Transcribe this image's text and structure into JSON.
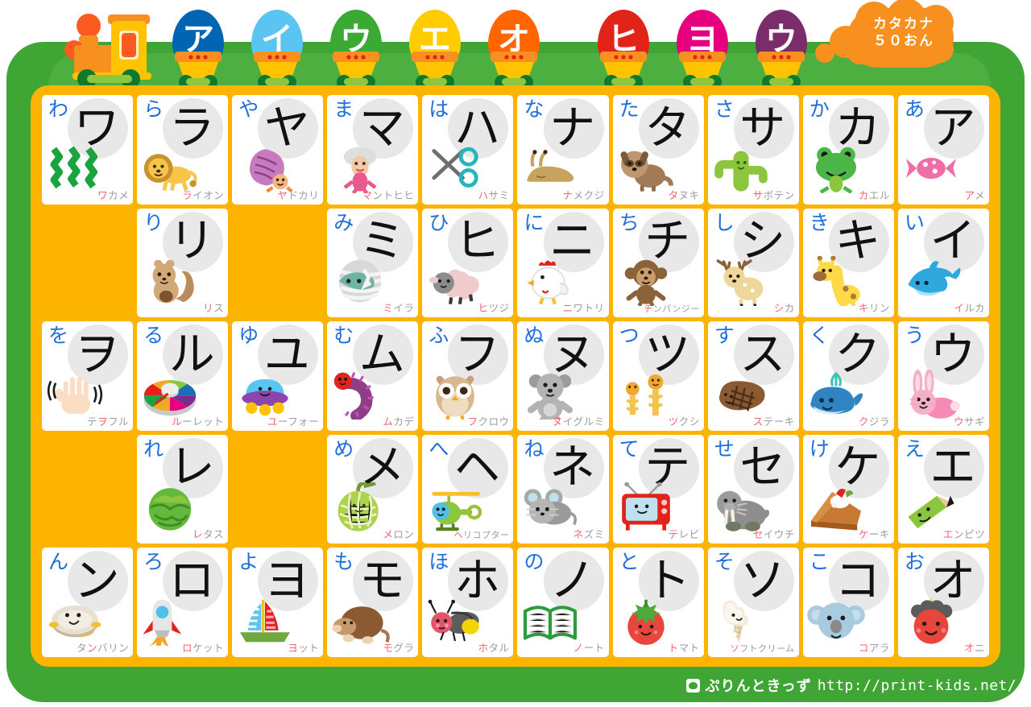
{
  "header": {
    "title_chars": [
      {
        "kana": "ア",
        "color": "#0066B3"
      },
      {
        "kana": "イ",
        "color": "#5BC5F2"
      },
      {
        "kana": "ウ",
        "color": "#3AAA35"
      },
      {
        "kana": "エ",
        "color": "#FFCC00"
      },
      {
        "kana": "オ",
        "color": "#FF6600"
      },
      {
        "kana": "ヒ",
        "color": "#E2231A"
      },
      {
        "kana": "ヨ",
        "color": "#E6007E"
      },
      {
        "kana": "ウ",
        "color": "#7B2D6B"
      }
    ],
    "cloud_line1": "カタカナ",
    "cloud_line2": "５０おん"
  },
  "footer": {
    "brand": "ぷりんときっず",
    "url": "http://print-kids.net/"
  },
  "colors": {
    "board_green": "#3FA535",
    "panel_orange": "#FCB400",
    "cell_white": "#FFFFFF",
    "kana_circle": "#E8E8E8",
    "hiragana_blue": "#1E6FD9",
    "katakana_black": "#111111",
    "word_gray": "#9B9B9B",
    "word_accent": "#F4636E",
    "smoke_orange": "#F7901E"
  },
  "grid": {
    "columns": 10,
    "rows": 5,
    "cells": [
      {
        "hira": "わ",
        "kata": "ワ",
        "word": "ワカメ",
        "hl": 0,
        "pic": "seaweed"
      },
      {
        "hira": "ら",
        "kata": "ラ",
        "word": "ライオン",
        "hl": 0,
        "pic": "lion"
      },
      {
        "hira": "や",
        "kata": "ヤ",
        "word": "ヤドカリ",
        "hl": 0,
        "pic": "hermit-crab"
      },
      {
        "hira": "ま",
        "kata": "マ",
        "word": "マントヒヒ",
        "hl": 0,
        "pic": "mandrill"
      },
      {
        "hira": "は",
        "kata": "ハ",
        "word": "ハサミ",
        "hl": 0,
        "pic": "scissors"
      },
      {
        "hira": "な",
        "kata": "ナ",
        "word": "ナメクジ",
        "hl": 0,
        "pic": "slug"
      },
      {
        "hira": "た",
        "kata": "タ",
        "word": "タヌキ",
        "hl": 0,
        "pic": "raccoon-dog"
      },
      {
        "hira": "さ",
        "kata": "サ",
        "word": "サボテン",
        "hl": 0,
        "pic": "cactus"
      },
      {
        "hira": "か",
        "kata": "カ",
        "word": "カエル",
        "hl": 0,
        "pic": "frog"
      },
      {
        "hira": "あ",
        "kata": "ア",
        "word": "アメ",
        "hl": 0,
        "pic": "candy"
      },
      {
        "hira": "",
        "kata": "",
        "word": "",
        "hl": -1,
        "pic": ""
      },
      {
        "hira": "り",
        "kata": "リ",
        "word": "リス",
        "hl": 0,
        "pic": "squirrel"
      },
      {
        "hira": "",
        "kata": "",
        "word": "",
        "hl": -1,
        "pic": ""
      },
      {
        "hira": "み",
        "kata": "ミ",
        "word": "ミイラ",
        "hl": 0,
        "pic": "mummy"
      },
      {
        "hira": "ひ",
        "kata": "ヒ",
        "word": "ヒツジ",
        "hl": 0,
        "pic": "sheep"
      },
      {
        "hira": "に",
        "kata": "ニ",
        "word": "ニワトリ",
        "hl": 0,
        "pic": "chicken"
      },
      {
        "hira": "ち",
        "kata": "チ",
        "word": "チンパンジー",
        "hl": 0,
        "pic": "chimpanzee"
      },
      {
        "hira": "し",
        "kata": "シ",
        "word": "シカ",
        "hl": 0,
        "pic": "deer"
      },
      {
        "hira": "き",
        "kata": "キ",
        "word": "キリン",
        "hl": 0,
        "pic": "giraffe"
      },
      {
        "hira": "い",
        "kata": "イ",
        "word": "イルカ",
        "hl": 0,
        "pic": "dolphin"
      },
      {
        "hira": "を",
        "kata": "ヲ",
        "word": "テヲフル",
        "hl": 1,
        "pic": "waving-hand"
      },
      {
        "hira": "る",
        "kata": "ル",
        "word": "ルーレット",
        "hl": 0,
        "pic": "roulette"
      },
      {
        "hira": "ゆ",
        "kata": "ユ",
        "word": "ユーフォー",
        "hl": 0,
        "pic": "ufo"
      },
      {
        "hira": "む",
        "kata": "ム",
        "word": "ムカデ",
        "hl": 0,
        "pic": "centipede"
      },
      {
        "hira": "ふ",
        "kata": "フ",
        "word": "フクロウ",
        "hl": 0,
        "pic": "owl"
      },
      {
        "hira": "ぬ",
        "kata": "ヌ",
        "word": "ヌイグルミ",
        "hl": 0,
        "pic": "stuffed-bear"
      },
      {
        "hira": "つ",
        "kata": "ツ",
        "word": "ツクシ",
        "hl": 0,
        "pic": "horsetail"
      },
      {
        "hira": "す",
        "kata": "ス",
        "word": "ステーキ",
        "hl": 0,
        "pic": "steak"
      },
      {
        "hira": "く",
        "kata": "ク",
        "word": "クジラ",
        "hl": 0,
        "pic": "whale"
      },
      {
        "hira": "う",
        "kata": "ウ",
        "word": "ウサギ",
        "hl": 0,
        "pic": "rabbit"
      },
      {
        "hira": "",
        "kata": "",
        "word": "",
        "hl": -1,
        "pic": ""
      },
      {
        "hira": "れ",
        "kata": "レ",
        "word": "レタス",
        "hl": 0,
        "pic": "lettuce"
      },
      {
        "hira": "",
        "kata": "",
        "word": "",
        "hl": -1,
        "pic": ""
      },
      {
        "hira": "め",
        "kata": "メ",
        "word": "メロン",
        "hl": 0,
        "pic": "melon"
      },
      {
        "hira": "へ",
        "kata": "ヘ",
        "word": "ヘリコプター",
        "hl": 0,
        "pic": "helicopter"
      },
      {
        "hira": "ね",
        "kata": "ネ",
        "word": "ネズミ",
        "hl": 0,
        "pic": "mouse"
      },
      {
        "hira": "て",
        "kata": "テ",
        "word": "テレビ",
        "hl": 0,
        "pic": "television"
      },
      {
        "hira": "せ",
        "kata": "セ",
        "word": "セイウチ",
        "hl": 0,
        "pic": "walrus"
      },
      {
        "hira": "け",
        "kata": "ケ",
        "word": "ケーキ",
        "hl": 0,
        "pic": "cake"
      },
      {
        "hira": "え",
        "kata": "エ",
        "word": "エンピツ",
        "hl": 0,
        "pic": "pencil"
      },
      {
        "hira": "ん",
        "kata": "ン",
        "word": "タンバリン",
        "hl": 1,
        "pic": "tambourine"
      },
      {
        "hira": "ろ",
        "kata": "ロ",
        "word": "ロケット",
        "hl": 0,
        "pic": "rocket"
      },
      {
        "hira": "よ",
        "kata": "ヨ",
        "word": "ヨット",
        "hl": 0,
        "pic": "yacht"
      },
      {
        "hira": "も",
        "kata": "モ",
        "word": "モグラ",
        "hl": 0,
        "pic": "mole"
      },
      {
        "hira": "ほ",
        "kata": "ホ",
        "word": "ホタル",
        "hl": 0,
        "pic": "firefly"
      },
      {
        "hira": "の",
        "kata": "ノ",
        "word": "ノート",
        "hl": 0,
        "pic": "notebook"
      },
      {
        "hira": "と",
        "kata": "ト",
        "word": "トマト",
        "hl": 0,
        "pic": "tomato"
      },
      {
        "hira": "そ",
        "kata": "ソ",
        "word": "ソフトクリーム",
        "hl": 0,
        "pic": "soft-serve"
      },
      {
        "hira": "こ",
        "kata": "コ",
        "word": "コアラ",
        "hl": 0,
        "pic": "koala"
      },
      {
        "hira": "お",
        "kata": "オ",
        "word": "オニ",
        "hl": 0,
        "pic": "ogre"
      }
    ]
  }
}
